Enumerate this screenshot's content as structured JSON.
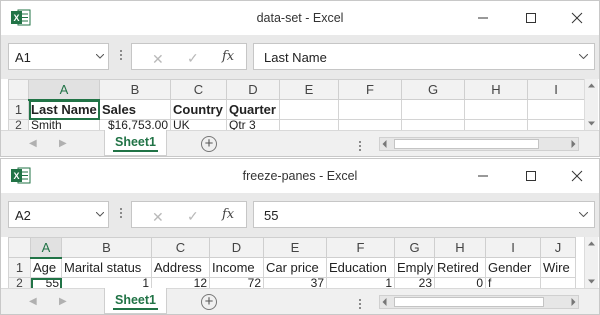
{
  "colors": {
    "accent": "#217346",
    "header_bg": "#f2f2f2",
    "formula_bar_bg": "#e9e9e9"
  },
  "icons": {
    "app": "excel-icon",
    "minimize": "minimize-icon",
    "maximize": "maximize-icon",
    "close": "close-icon",
    "name_dropdown": "chevron-down-icon",
    "cancel": "cancel-icon",
    "enter": "checkmark-icon",
    "function": "fx-icon",
    "add_sheet": "plus-circle-icon"
  },
  "windows": [
    {
      "title": "data-set - Excel",
      "name_box": "A1",
      "formula": "Last Name",
      "fx_label": "fx",
      "col_headers": [
        "A",
        "B",
        "C",
        "D",
        "E",
        "F",
        "G",
        "H",
        "I"
      ],
      "selected_col": "A",
      "rows": [
        {
          "num": "1",
          "cells": [
            "Last Name",
            "Sales",
            "Country",
            "Quarter",
            "",
            "",
            "",
            "",
            ""
          ]
        },
        {
          "num": "2",
          "cells": [
            "Smith",
            "$16,753.00",
            "UK",
            "Qtr 3",
            "",
            "",
            "",
            "",
            ""
          ]
        }
      ],
      "bold_cols": [
        0,
        1,
        2,
        3
      ],
      "sheet_tab": "Sheet1",
      "scroll_thumb_fraction": 0.85
    },
    {
      "title": "freeze-panes - Excel",
      "name_box": "A2",
      "formula": "55",
      "fx_label": "fx",
      "col_headers": [
        "A",
        "B",
        "C",
        "D",
        "E",
        "F",
        "G",
        "H",
        "I",
        "J"
      ],
      "selected_col": "A",
      "rows": [
        {
          "num": "1",
          "cells": [
            "Age",
            "Marital status",
            "Address",
            "Income",
            "Car price",
            "Education",
            "Emply",
            "Retired",
            "Gender",
            "Wire"
          ]
        },
        {
          "num": "2",
          "cells": [
            "55",
            "1",
            "12",
            "72",
            "37",
            "1",
            "23",
            "0",
            "f",
            ""
          ]
        }
      ],
      "bold_cols": [],
      "sheet_tab": "Sheet1",
      "scroll_thumb_fraction": 0.88
    }
  ]
}
